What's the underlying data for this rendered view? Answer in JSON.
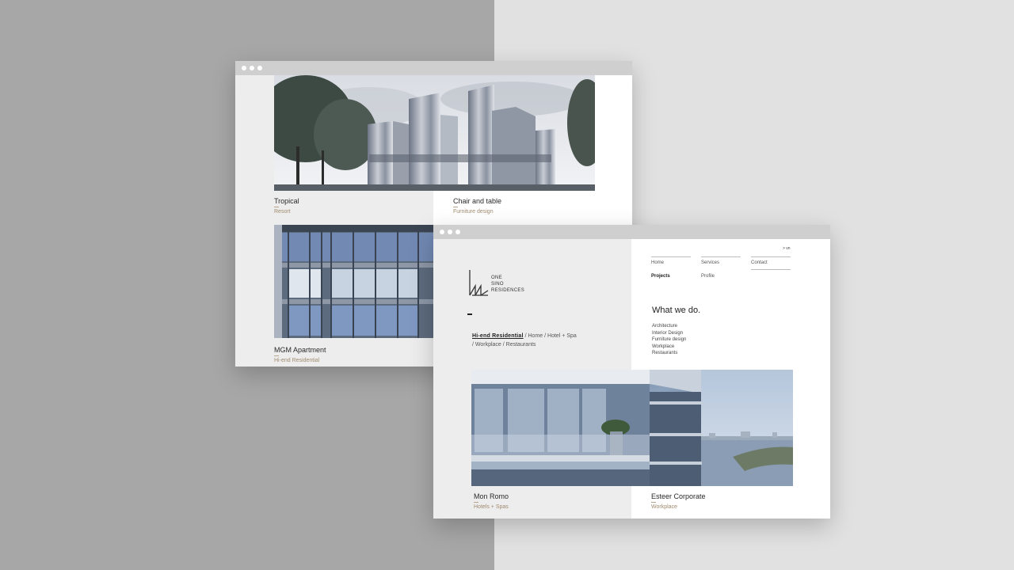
{
  "colors": {
    "left_background": "#a7a7a7",
    "right_background": "#e1e1e1",
    "titlebar": "#cfcfcf",
    "caption_subtitle": "#a08a6e"
  },
  "window_back": {
    "projects": [
      {
        "title": "Tropical",
        "category": "Resort"
      },
      {
        "title": "Chair and table",
        "category": "Furniture design"
      },
      {
        "title": "MGM Apartment",
        "category": "Hi-end Residential"
      }
    ]
  },
  "window_front": {
    "language_switch": "> vn",
    "logo": {
      "line1": "ONE",
      "line2": "SINO",
      "line3": "RESIDENCES"
    },
    "nav": {
      "home": "Home",
      "services": "Services",
      "contact": "Contact",
      "projects": "Projects",
      "profile": "Profile"
    },
    "heading": "What we do.",
    "services": [
      "Architecture",
      "Interior Design",
      "Furniture design",
      "Workplace",
      "Restaurants"
    ],
    "filters": {
      "active": "Hi-end Residential",
      "rest1": " / Home / Hotel + Spa",
      "rest2": "/ Workplace / Restaurants"
    },
    "projects": [
      {
        "title": "Mon Romo",
        "category": "Hotels + Spas"
      },
      {
        "title": "Esteer Corporate",
        "category": "Workplace"
      }
    ]
  }
}
